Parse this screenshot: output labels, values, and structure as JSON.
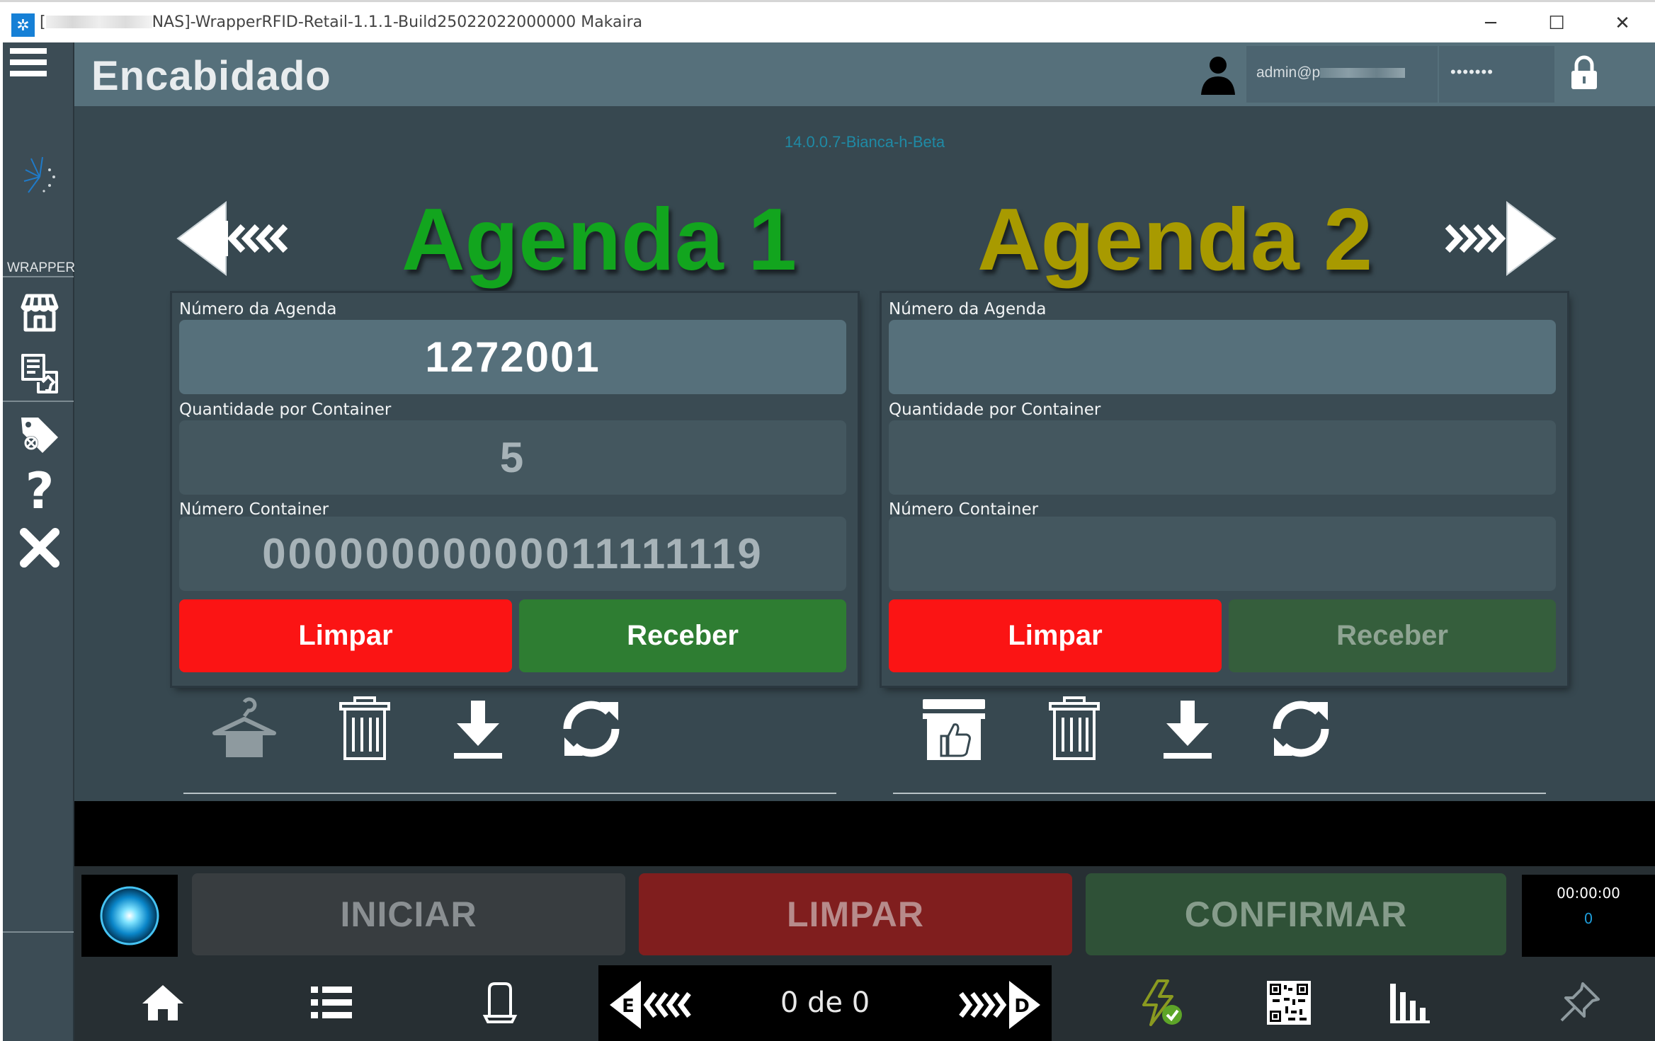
{
  "window": {
    "title_prefix": "[",
    "title": "NAS]-WrapperRFID-Retail-1.1.1-Build25022022000000 Makaira",
    "minimize_glyph": "─",
    "maximize_glyph": "☐",
    "close_glyph": "✕"
  },
  "sidebar": {
    "section_label": "WRAPPER",
    "icons": [
      "menu-icon",
      "brand-logo",
      "store-icon",
      "receipt-icon",
      "tag-remove-icon",
      "help-icon",
      "close-icon"
    ]
  },
  "header": {
    "title": "Encabidado",
    "user": "admin@p",
    "password_mask": "•••••••"
  },
  "version": "14.0.0.7-Bianca-h-Beta",
  "agenda1": {
    "title": "Agenda 1",
    "title_color": "#12a51e",
    "numero_label": "Número da Agenda",
    "numero_value": "1272001",
    "quantidade_label": "Quantidade por Container",
    "quantidade_value": "5",
    "container_label": "Número Container",
    "container_value": "00000000000011111119",
    "limpar_label": "Limpar",
    "receber_label": "Receber"
  },
  "agenda2": {
    "title": "Agenda 2",
    "title_color": "#a89a00",
    "numero_label": "Número da Agenda",
    "numero_value": "",
    "quantidade_label": "Quantidade por Container",
    "quantidade_value": "",
    "container_label": "Número Container",
    "container_value": "",
    "limpar_label": "Limpar",
    "receber_label": "Receber"
  },
  "actions": {
    "iniciar": "INICIAR",
    "limpar": "LIMPAR",
    "confirmar": "CONFIRMAR",
    "timer": "00:00:00",
    "count": "0"
  },
  "pager": {
    "text": "0 de 0",
    "prev_letter": "E",
    "next_letter": "D"
  },
  "colors": {
    "accent_red": "#fb1414",
    "accent_green": "#2e7d32",
    "header_bg": "#56707b",
    "main_bg": "#374850",
    "sidebar_bg": "#3c4c55"
  }
}
